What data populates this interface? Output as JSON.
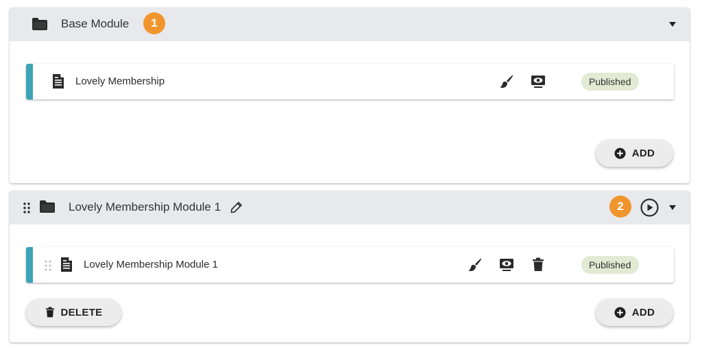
{
  "modules": [
    {
      "title": "Base Module",
      "step_badge": "1",
      "lessons": [
        {
          "title": "Lovely Membership",
          "status": "Published"
        }
      ],
      "add_label": "ADD"
    },
    {
      "title": "Lovely Membership Module 1",
      "step_badge": "2",
      "lessons": [
        {
          "title": "Lovely Membership Module 1",
          "status": "Published"
        }
      ],
      "add_label": "ADD",
      "delete_label": "DELETE"
    }
  ],
  "icons": {
    "folder": "folder-icon",
    "document": "document-icon",
    "edit_module": "pencil-icon",
    "design": "paintbrush-icon",
    "preview": "eye-monitor-icon",
    "delete": "trash-icon",
    "play": "play-circle-icon",
    "drag": "drag-handle-icon",
    "expand": "caret-down-icon",
    "add": "plus-circle-icon"
  },
  "colors": {
    "header_bg": "#e8e9ec",
    "accent": "#3ea3b5",
    "step_badge": "#f0952e",
    "published_badge": "#e1ead2"
  }
}
